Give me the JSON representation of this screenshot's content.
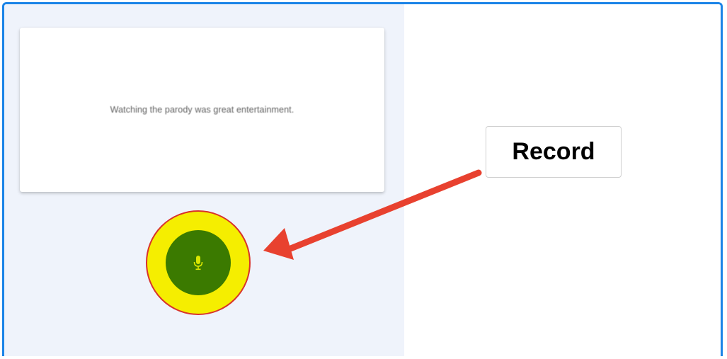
{
  "card": {
    "sentence": "Watching the parody was great entertainment."
  },
  "mic_button": {
    "icon": "microphone-icon",
    "color": "#3b7a00",
    "highlight_color": "#f5ee00",
    "ring_border_color": "#d8332b"
  },
  "callout": {
    "label": "Record",
    "arrow_color": "#e8412f"
  },
  "theme": {
    "frame_border": "#1b84e7",
    "left_panel_bg": "#eff3fb"
  }
}
